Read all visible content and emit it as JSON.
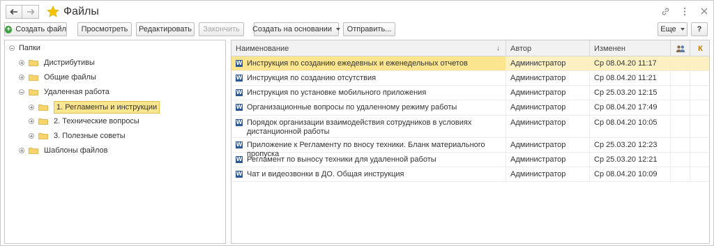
{
  "header": {
    "title": "Файлы",
    "back_icon": "arrow-left-icon",
    "forward_icon": "arrow-right-icon",
    "favorite_icon": "star-icon",
    "accent": "#f5c400"
  },
  "toolbar": {
    "create_label": "Создать файл",
    "view_label": "Просмотреть",
    "edit_label": "Редактировать",
    "finish_label": "Закончить",
    "based_on_label": "Создать на основании",
    "send_label": "Отправить...",
    "more_label": "Еще"
  },
  "tree": {
    "root": "Папки",
    "items": [
      {
        "label": "Дистрибутивы"
      },
      {
        "label": "Общие файлы"
      },
      {
        "label": "Удаленная работа"
      },
      {
        "label": "1. Регламенты и инструкции"
      },
      {
        "label": "2. Технические вопросы"
      },
      {
        "label": "3. Полезные советы"
      },
      {
        "label": "Шаблоны файлов"
      }
    ]
  },
  "table": {
    "columns": {
      "name": "Наименование",
      "author": "Автор",
      "modified": "Изменен",
      "k": "К"
    },
    "rows": [
      {
        "name": "Инструкция по созданию ежедевных и еженедельных отчетов",
        "author": "Администратор",
        "modified": "Ср 08.04.20 11:17"
      },
      {
        "name": "Инструкция по созданию отсутствия",
        "author": "Администратор",
        "modified": "Ср 08.04.20 11:21"
      },
      {
        "name": "Инструкция по установке мобильного приложения",
        "author": "Администратор",
        "modified": "Ср 25.03.20 12:15"
      },
      {
        "name": "Организационные вопросы по удаленному режиму работы",
        "author": "Администратор",
        "modified": "Ср 08.04.20 17:49"
      },
      {
        "name": "Порядок организации взаимодействия сотрудников в условиях дистанционной работы",
        "author": "Администратор",
        "modified": "Ср 08.04.20 10:05"
      },
      {
        "name": "Приложение к Регламенту по вносу техники. Бланк материального пропуска",
        "author": "Администратор",
        "modified": "Ср 25.03.20 12:23"
      },
      {
        "name": "Регламент по выносу техники для удаленной работы",
        "author": "Администратор",
        "modified": "Ср 25.03.20 12:21"
      },
      {
        "name": "Чат и видеозвонки в ДО. Общая инструкция",
        "author": "Администратор",
        "modified": "Ср 08.04.20 10:09"
      }
    ]
  }
}
